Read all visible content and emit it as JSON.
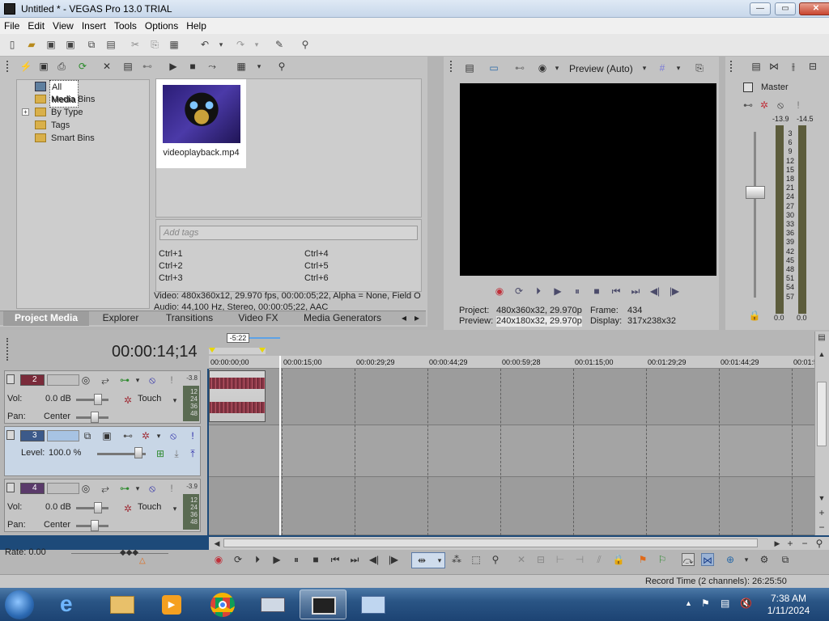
{
  "window": {
    "title": "Untitled * - VEGAS Pro 13.0 TRIAL",
    "minimize": "—",
    "maximize": "▭",
    "close": "✕"
  },
  "menu": [
    "File",
    "Edit",
    "View",
    "Insert",
    "Tools",
    "Options",
    "Help"
  ],
  "explorer": {
    "tree": [
      "All Media",
      "Media Bins",
      "By Type",
      "Tags",
      "Smart Bins"
    ],
    "expand_glyph": "+"
  },
  "media": {
    "file_name": "videoplayback.mp4",
    "tags_placeholder": "Add tags",
    "shortcuts": [
      "Ctrl+1",
      "Ctrl+4",
      "Ctrl+2",
      "Ctrl+5",
      "Ctrl+3",
      "Ctrl+6"
    ],
    "info_video": "Video: 480x360x12, 29.970 fps, 00:00:05;22, Alpha = None, Field O",
    "info_audio": "Audio: 44,100 Hz, Stereo, 00:00:05;22, AAC"
  },
  "tabs": [
    "Project Media",
    "Explorer",
    "Transitions",
    "Video FX",
    "Media Generators"
  ],
  "preview": {
    "mode": "Preview (Auto)",
    "project_label": "Project:",
    "project_value": "480x360x32, 29.970p",
    "frame_label": "Frame:",
    "frame_value": "434",
    "preview_label": "Preview:",
    "preview_value": "240x180x32, 29.970p",
    "display_label": "Display:",
    "display_value": "317x238x32"
  },
  "master": {
    "title": "Master",
    "peak_left": "-13.9",
    "peak_right": "-14.5",
    "scale": [
      "3",
      "6",
      "9",
      "12",
      "15",
      "18",
      "21",
      "24",
      "27",
      "30",
      "33",
      "36",
      "39",
      "42",
      "45",
      "48",
      "51",
      "54",
      "57"
    ],
    "floor_left": "0.0",
    "floor_right": "0.0"
  },
  "timeline": {
    "timecode": "00:00:14;14",
    "loop_label": "-5:22",
    "ruler": [
      "00:00:00;00",
      "00:00:15;00",
      "00:00:29;29",
      "00:00:44;29",
      "00:00:59;28",
      "00:01:15;00",
      "00:01:29;29",
      "00:01:44;29",
      "00:01:5"
    ]
  },
  "tracks": [
    {
      "num": "2",
      "type": "audio",
      "vol_label": "Vol:",
      "vol_value": "0.0 dB",
      "pan_label": "Pan:",
      "pan_value": "Center",
      "mode": "Touch",
      "meter_top": "-3.8",
      "meter_scale": [
        "12",
        "24",
        "36",
        "48"
      ]
    },
    {
      "num": "3",
      "type": "video",
      "level_label": "Level:",
      "level_value": "100.0 %"
    },
    {
      "num": "4",
      "type": "audio",
      "vol_label": "Vol:",
      "vol_value": "0.0 dB",
      "pan_label": "Pan:",
      "pan_value": "Center",
      "mode": "Touch",
      "meter_top": "-3.9",
      "meter_scale": [
        "12",
        "24",
        "36",
        "48"
      ]
    }
  ],
  "rate_label": "Rate: 0.00",
  "status": {
    "record_time": "Record Time (2 channels): 26:25:50"
  },
  "clock": {
    "time": "7:38 AM",
    "date": "1/11/2024"
  },
  "colors": {
    "accent": "#1d4a79",
    "audio_track": "#7a2b3a",
    "video_track": "#3c5a8a"
  }
}
